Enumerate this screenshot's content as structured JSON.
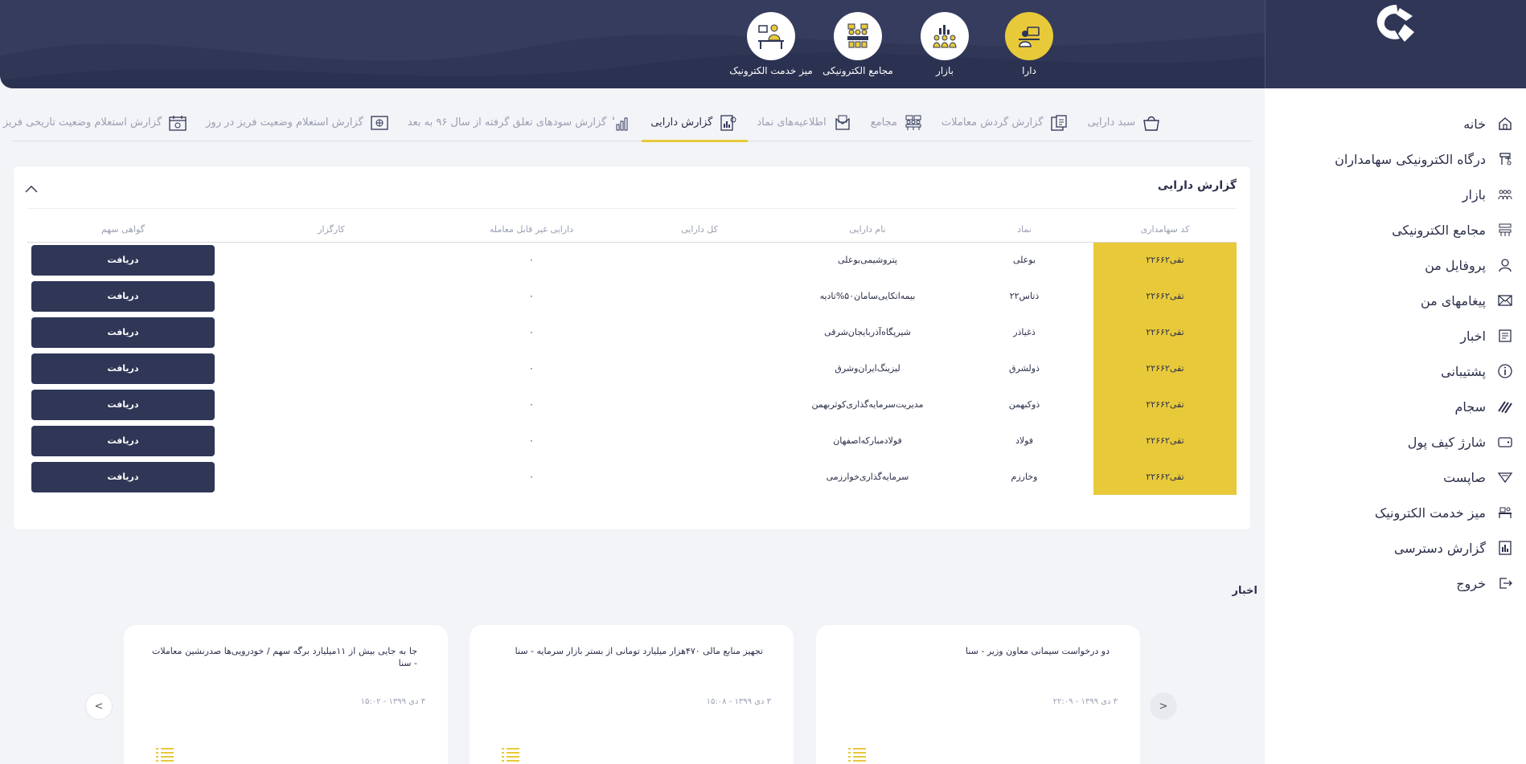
{
  "colors": {
    "navy": "#2f3656",
    "gold": "#e8c93a",
    "muted": "#9aa0b2"
  },
  "top_nav": [
    {
      "label": "دارا",
      "icon": "desk-person-icon",
      "active": true
    },
    {
      "label": "بازار",
      "icon": "people-chart-icon",
      "active": false
    },
    {
      "label": "مجامع الکترونیکی",
      "icon": "meeting-icon",
      "active": false
    },
    {
      "label": "میز خدمت الکترونیک",
      "icon": "service-desk-icon",
      "active": false
    }
  ],
  "sidebar": {
    "items": [
      {
        "label": "خانه",
        "icon": "home-icon"
      },
      {
        "label": "درگاه الکترونیکی سهامداران",
        "icon": "gateway-icon"
      },
      {
        "label": "بازار",
        "icon": "market-icon"
      },
      {
        "label": "مجامع الکترونیکی",
        "icon": "meeting-icon"
      },
      {
        "label": "پروفایل من",
        "icon": "user-icon"
      },
      {
        "label": "پیغامهای من",
        "icon": "envelope-icon"
      },
      {
        "label": "اخبار",
        "icon": "newspaper-icon"
      },
      {
        "label": "پشتیبانی",
        "icon": "info-icon"
      },
      {
        "label": "سجام",
        "icon": "sejam-icon"
      },
      {
        "label": "شارژ کیف پول",
        "icon": "wallet-icon"
      },
      {
        "label": "صاپست",
        "icon": "sapost-icon"
      },
      {
        "label": "میز خدمت الکترونیک",
        "icon": "desk-icon"
      },
      {
        "label": "گزارش دسترسی",
        "icon": "report-icon"
      },
      {
        "label": "خروج",
        "icon": "logout-icon"
      }
    ]
  },
  "tabs": [
    {
      "label": "سبد دارایی",
      "icon": "basket-icon",
      "active": false
    },
    {
      "label": "گزارش گردش معاملات",
      "icon": "transactions-icon",
      "active": false
    },
    {
      "label": "مجامع",
      "icon": "assembly-icon",
      "active": false
    },
    {
      "label": "اطلاعیه‌های نماد",
      "icon": "announcement-icon",
      "active": false
    },
    {
      "label": "گزارش دارایی",
      "icon": "asset-report-icon",
      "active": true
    },
    {
      "label": "گزارش سودهای تعلق گرفته از سال ۹۶ به بعد",
      "icon": "percent-chart-icon",
      "active": false
    },
    {
      "label": "گزارش استعلام وضعیت فریز در روز",
      "icon": "freeze-day-icon",
      "active": false
    },
    {
      "label": "گزارش استعلام وضعیت تاریخی فریز",
      "icon": "freeze-history-icon",
      "active": false
    }
  ],
  "asset_report": {
    "title": "گزارش دارایی",
    "columns": [
      "کد سهامداری",
      "نماد",
      "نام دارایی",
      "کل دارایی",
      "دارایی غیر قابل معامله",
      "کارگزار",
      "گواهی سهم"
    ],
    "button_label": "دریافت",
    "rows": [
      {
        "code": "تقی۲۲۶۶۲",
        "symbol": "بوعلی",
        "name": "پتروشیمی‌بوعلی",
        "total": "",
        "non_tradable": "۰",
        "broker": ""
      },
      {
        "code": "تقی۲۲۶۶۲",
        "symbol": "ذتاس۲۲",
        "name": "بیمه‌اتکایی‌سامان۵۰%تادیه",
        "total": "",
        "non_tradable": "۰",
        "broker": ""
      },
      {
        "code": "تقی۲۲۶۶۲",
        "symbol": "ذغیاذر",
        "name": "شیرپگاه‌آذربایجان‌شرقی",
        "total": "",
        "non_tradable": "۰",
        "broker": ""
      },
      {
        "code": "تقی۲۲۶۶۲",
        "symbol": "ذولشرق",
        "name": "لیزینگ‌ایران‌وشرق",
        "total": "",
        "non_tradable": "۰",
        "broker": ""
      },
      {
        "code": "تقی۲۲۶۶۲",
        "symbol": "ذوکبهمن",
        "name": "مدیریت‌سرمایه‌گذاری‌کوثربهمن",
        "total": "",
        "non_tradable": "۰",
        "broker": ""
      },
      {
        "code": "تقی۲۲۶۶۲",
        "symbol": "فولاد",
        "name": "فولادمبارکه‌اصفهان",
        "total": "",
        "non_tradable": "۰",
        "broker": ""
      },
      {
        "code": "تقی۲۲۶۶۲",
        "symbol": "وخارزم",
        "name": "سرمایه‌گذاری‌خوارزمی",
        "total": "",
        "non_tradable": "۰",
        "broker": ""
      }
    ]
  },
  "news": {
    "title": "اخبار",
    "prev": ">",
    "next": "<",
    "items": [
      {
        "text": "دو درخواست سیمانی معاون وزیر - سنا",
        "date": "۳ دی ۱۳۹۹ - ۲۲:۰۹"
      },
      {
        "text": "تجهیز منابع مالی ۴۷۰هزار میلیارد تومانی از بستر بازار سرمایه - سنا",
        "date": "۳ دی ۱۳۹۹ - ۱۵:۰۸"
      },
      {
        "text": "جا به جایی بیش از ۱۱میلیارد برگه سهم / خودرویی‌ها صدرنشین معاملات - سنا",
        "date": "۳ دی ۱۳۹۹ - ۱۵:۰۲"
      }
    ]
  }
}
